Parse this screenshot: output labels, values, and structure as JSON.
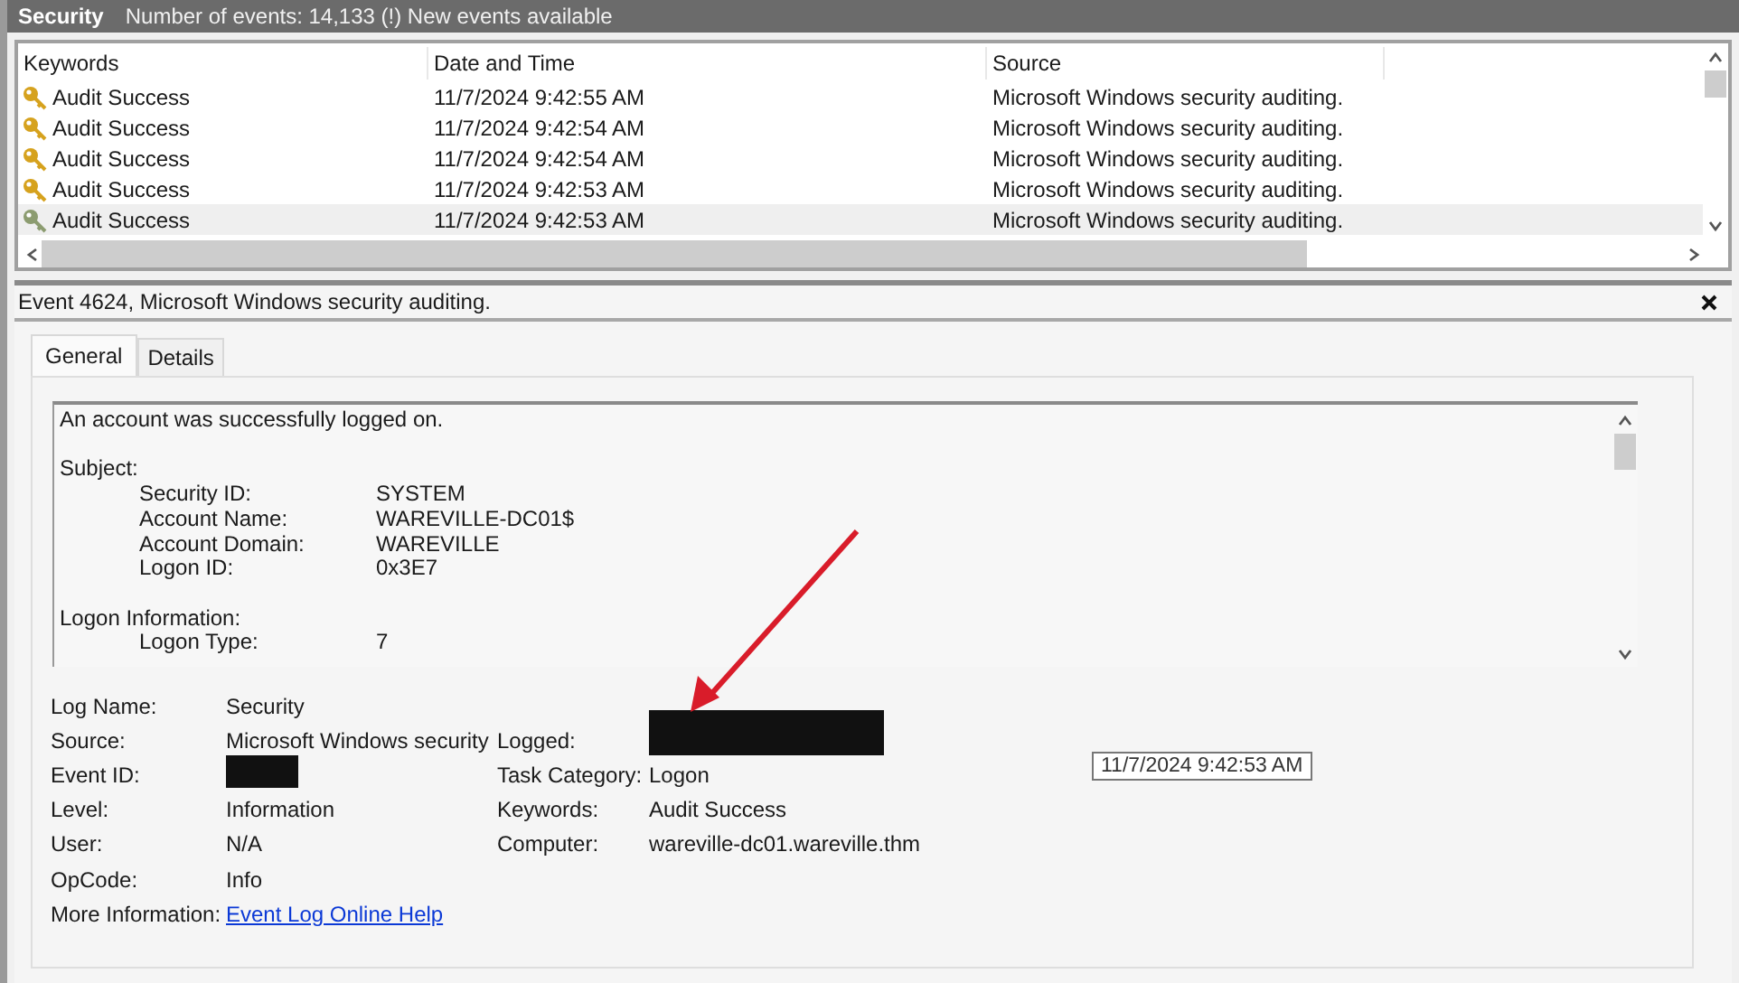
{
  "header": {
    "title": "Security",
    "summary": "Number of events: 14,133 (!) New events available"
  },
  "event_list": {
    "columns": [
      "Keywords",
      "Date and Time",
      "Source"
    ],
    "rows": [
      {
        "keywords": "Audit Success",
        "date_time": "11/7/2024 9:42:55 AM",
        "source": "Microsoft Windows security auditing.",
        "selected": false
      },
      {
        "keywords": "Audit Success",
        "date_time": "11/7/2024 9:42:54 AM",
        "source": "Microsoft Windows security auditing.",
        "selected": false
      },
      {
        "keywords": "Audit Success",
        "date_time": "11/7/2024 9:42:54 AM",
        "source": "Microsoft Windows security auditing.",
        "selected": false
      },
      {
        "keywords": "Audit Success",
        "date_time": "11/7/2024 9:42:53 AM",
        "source": "Microsoft Windows security auditing.",
        "selected": false
      },
      {
        "keywords": "Audit Success",
        "date_time": "11/7/2024 9:42:53 AM",
        "source": "Microsoft Windows security auditing.",
        "selected": true
      }
    ]
  },
  "details": {
    "title": "Event 4624, Microsoft Windows security auditing.",
    "tabs": [
      {
        "label": "General",
        "selected": true
      },
      {
        "label": "Details",
        "selected": false
      }
    ],
    "description": [
      {
        "kind": "text",
        "text": "An account was successfully logged on."
      },
      {
        "kind": "heading",
        "text": "Subject:"
      },
      {
        "kind": "field",
        "label": "Security ID:",
        "value": "SYSTEM"
      },
      {
        "kind": "field",
        "label": "Account Name:",
        "value": "WAREVILLE-DC01$"
      },
      {
        "kind": "field",
        "label": "Account Domain:",
        "value": "WAREVILLE"
      },
      {
        "kind": "field",
        "label": "Logon ID:",
        "value": "0x3E7"
      },
      {
        "kind": "heading",
        "text": "Logon Information:"
      },
      {
        "kind": "field",
        "label": "Logon Type:",
        "value": "7"
      }
    ],
    "properties_left": [
      {
        "label": "Log Name:",
        "kind": "text",
        "value": "Security"
      },
      {
        "label": "Source:",
        "kind": "text",
        "value": "Microsoft Windows security"
      },
      {
        "label": "Event ID:",
        "kind": "redacted"
      },
      {
        "label": "Level:",
        "kind": "text",
        "value": "Information"
      },
      {
        "label": "User:",
        "kind": "text",
        "value": "N/A"
      },
      {
        "label": "OpCode:",
        "kind": "text",
        "value": "Info"
      },
      {
        "label": "More Information:",
        "kind": "link",
        "value": "Event Log Online Help"
      }
    ],
    "properties_right": [
      {
        "label": "Logged:",
        "kind": "redacted"
      },
      {
        "label": "Task Category:",
        "kind": "text",
        "value": "Logon"
      },
      {
        "label": "Keywords:",
        "kind": "text",
        "value": "Audit Success"
      },
      {
        "label": "Computer:",
        "kind": "text",
        "value": "wareville-dc01.wareville.thm"
      }
    ],
    "tooltip": "11/7/2024 9:42:53 AM"
  }
}
